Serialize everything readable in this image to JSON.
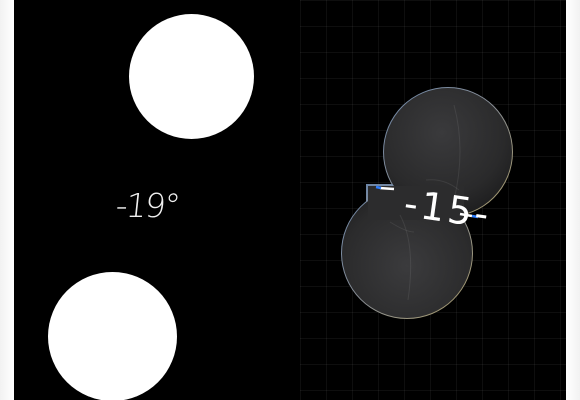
{
  "left_dial": {
    "temperature": "-19°"
  },
  "right_dial": {
    "temperature": "-15-"
  },
  "colors": {
    "background": "#000000",
    "orb": "#ffffff",
    "accent": "#2f7fff"
  }
}
